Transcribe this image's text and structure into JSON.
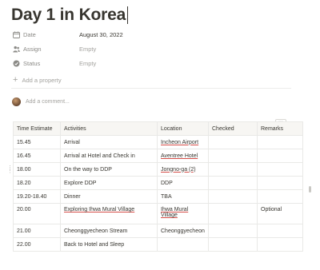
{
  "page": {
    "title": "Day 1 in Korea"
  },
  "properties": [
    {
      "name": "Date",
      "value": "August 30, 2022",
      "icon": "calendar-icon",
      "empty": false
    },
    {
      "name": "Assign",
      "value": "Empty",
      "icon": "people-icon",
      "empty": true
    },
    {
      "name": "Status",
      "value": "Empty",
      "icon": "status-icon",
      "empty": true
    }
  ],
  "add_property_label": "Add a property",
  "comment_placeholder": "Add a comment...",
  "table": {
    "headers": [
      "Time Estimate",
      "Activities",
      "Location",
      "Checked",
      "Remarks"
    ],
    "rows": [
      [
        "15.45",
        "Arrival",
        "Incheon Airport",
        "",
        ""
      ],
      [
        "16.45",
        "Arrival at Hotel and Check in",
        "Aventree Hotel",
        "",
        ""
      ],
      [
        "18.00",
        "On the way to DDP",
        "Jongno-ga (2)",
        "",
        ""
      ],
      [
        "18.20",
        "Explore DDP",
        "DDP",
        "",
        ""
      ],
      [
        "19.20-18.40",
        "Dinner",
        "TBA",
        "",
        ""
      ],
      [
        "20.00",
        "Exploring Ihwa Mural Village",
        "Ihwa Mural Village",
        "",
        "Optional"
      ],
      [
        "21.00",
        "Cheonggyecheon Stream",
        "Cheonggyecheon",
        "",
        ""
      ],
      [
        "22.00",
        "Back to Hotel and Sleep",
        "",
        "",
        ""
      ]
    ]
  },
  "colors": {
    "text": "#37352f",
    "muted": "#8b8a86",
    "border": "#e9e9e7",
    "header_bg": "#f7f6f3",
    "spellcheck": "#d44c47"
  }
}
